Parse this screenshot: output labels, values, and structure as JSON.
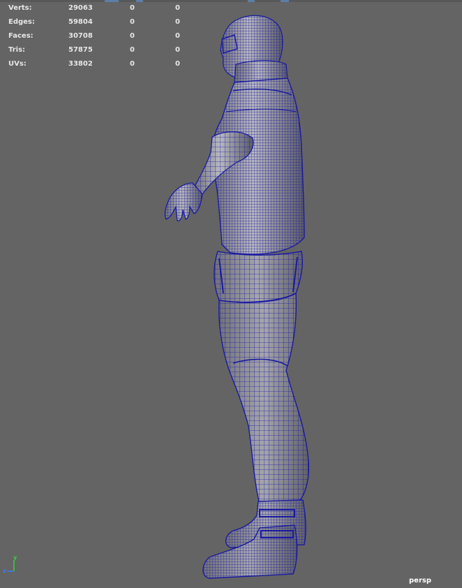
{
  "stats": [
    {
      "label": "Verts:",
      "values": [
        "29063",
        "0",
        "0"
      ]
    },
    {
      "label": "Edges:",
      "values": [
        "59804",
        "0",
        "0"
      ]
    },
    {
      "label": "Faces:",
      "values": [
        "30708",
        "0",
        "0"
      ]
    },
    {
      "label": "Tris:",
      "values": [
        "57875",
        "0",
        "0"
      ]
    },
    {
      "label": "UVs:",
      "values": [
        "33802",
        "0",
        "0"
      ]
    }
  ],
  "camera": "persp",
  "axis": {
    "y": "y",
    "z": "z"
  },
  "colors": {
    "background": "#646464",
    "wireframe": "#1a1aa0",
    "hud_text": "#e6e6e6",
    "axis_y": "#3ad13a",
    "axis_z": "#3a7cff"
  }
}
